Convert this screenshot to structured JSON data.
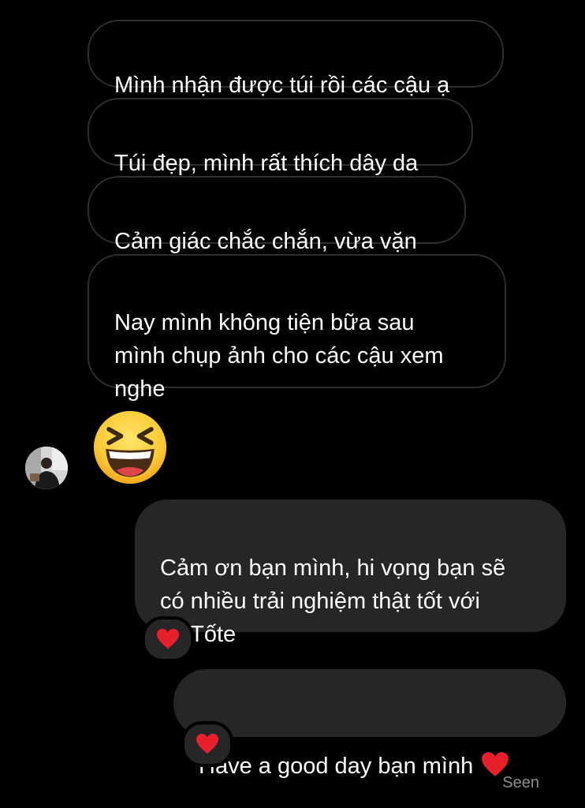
{
  "messages": {
    "received": [
      {
        "text": "Mình nhận được túi rồi các cậu ạ"
      },
      {
        "text": "Túi đẹp, mình rất thích dây da"
      },
      {
        "text": "Cảm giác chắc chắn, vừa vặn"
      },
      {
        "text": "Nay mình không tiện bữa sau\nmình chụp ảnh cho các cậu xem\nnghe"
      }
    ],
    "received_emoji": "grinning-squinting-face-icon",
    "sent": [
      {
        "text": "Cảm ơn bạn mình, hi vọng bạn sẽ\ncó nhiều trải nghiệm thật tốt với\ntúi Tốte",
        "reaction": "red-heart-icon"
      },
      {
        "text": "Have a good day bạn mình",
        "inline_emoji": "red-heart-icon",
        "reaction": "red-heart-icon"
      }
    ]
  },
  "status": {
    "seen": "Seen"
  },
  "colors": {
    "background": "#000000",
    "sent_bubble": "#262626",
    "received_border": "#2e2e2e",
    "heart": "#e8202c",
    "seen_text": "#8e8e8e"
  }
}
